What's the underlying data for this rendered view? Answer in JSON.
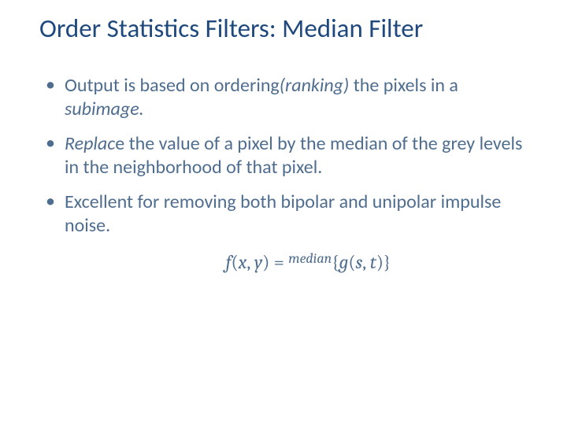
{
  "title": "Order Statistics Filters: Median Filter",
  "bullets": {
    "b1": {
      "pre": "Output is based on ordering",
      "ital": "(ranking) ",
      "post1": "the pixels in a ",
      "ital2": "subimage."
    },
    "b2": {
      "ital": "Replac",
      "post": "e the value of a pixel by the median of the grey levels in the neighborhood of that pixel."
    },
    "b3": {
      "text": "Excellent for removing both bipolar and unipolar impulse noise."
    }
  },
  "formula": {
    "f1": "f",
    "open1": "(",
    "x": "x",
    "comma1": ", ",
    "y": "y",
    "close1": ")",
    "eq": " = ",
    "median": "median",
    "lbrace": "{",
    "g": "g",
    "open2": "(",
    "s": "s",
    "comma2": ", ",
    "t": "t",
    "close2": ")",
    "rbrace": "}"
  }
}
